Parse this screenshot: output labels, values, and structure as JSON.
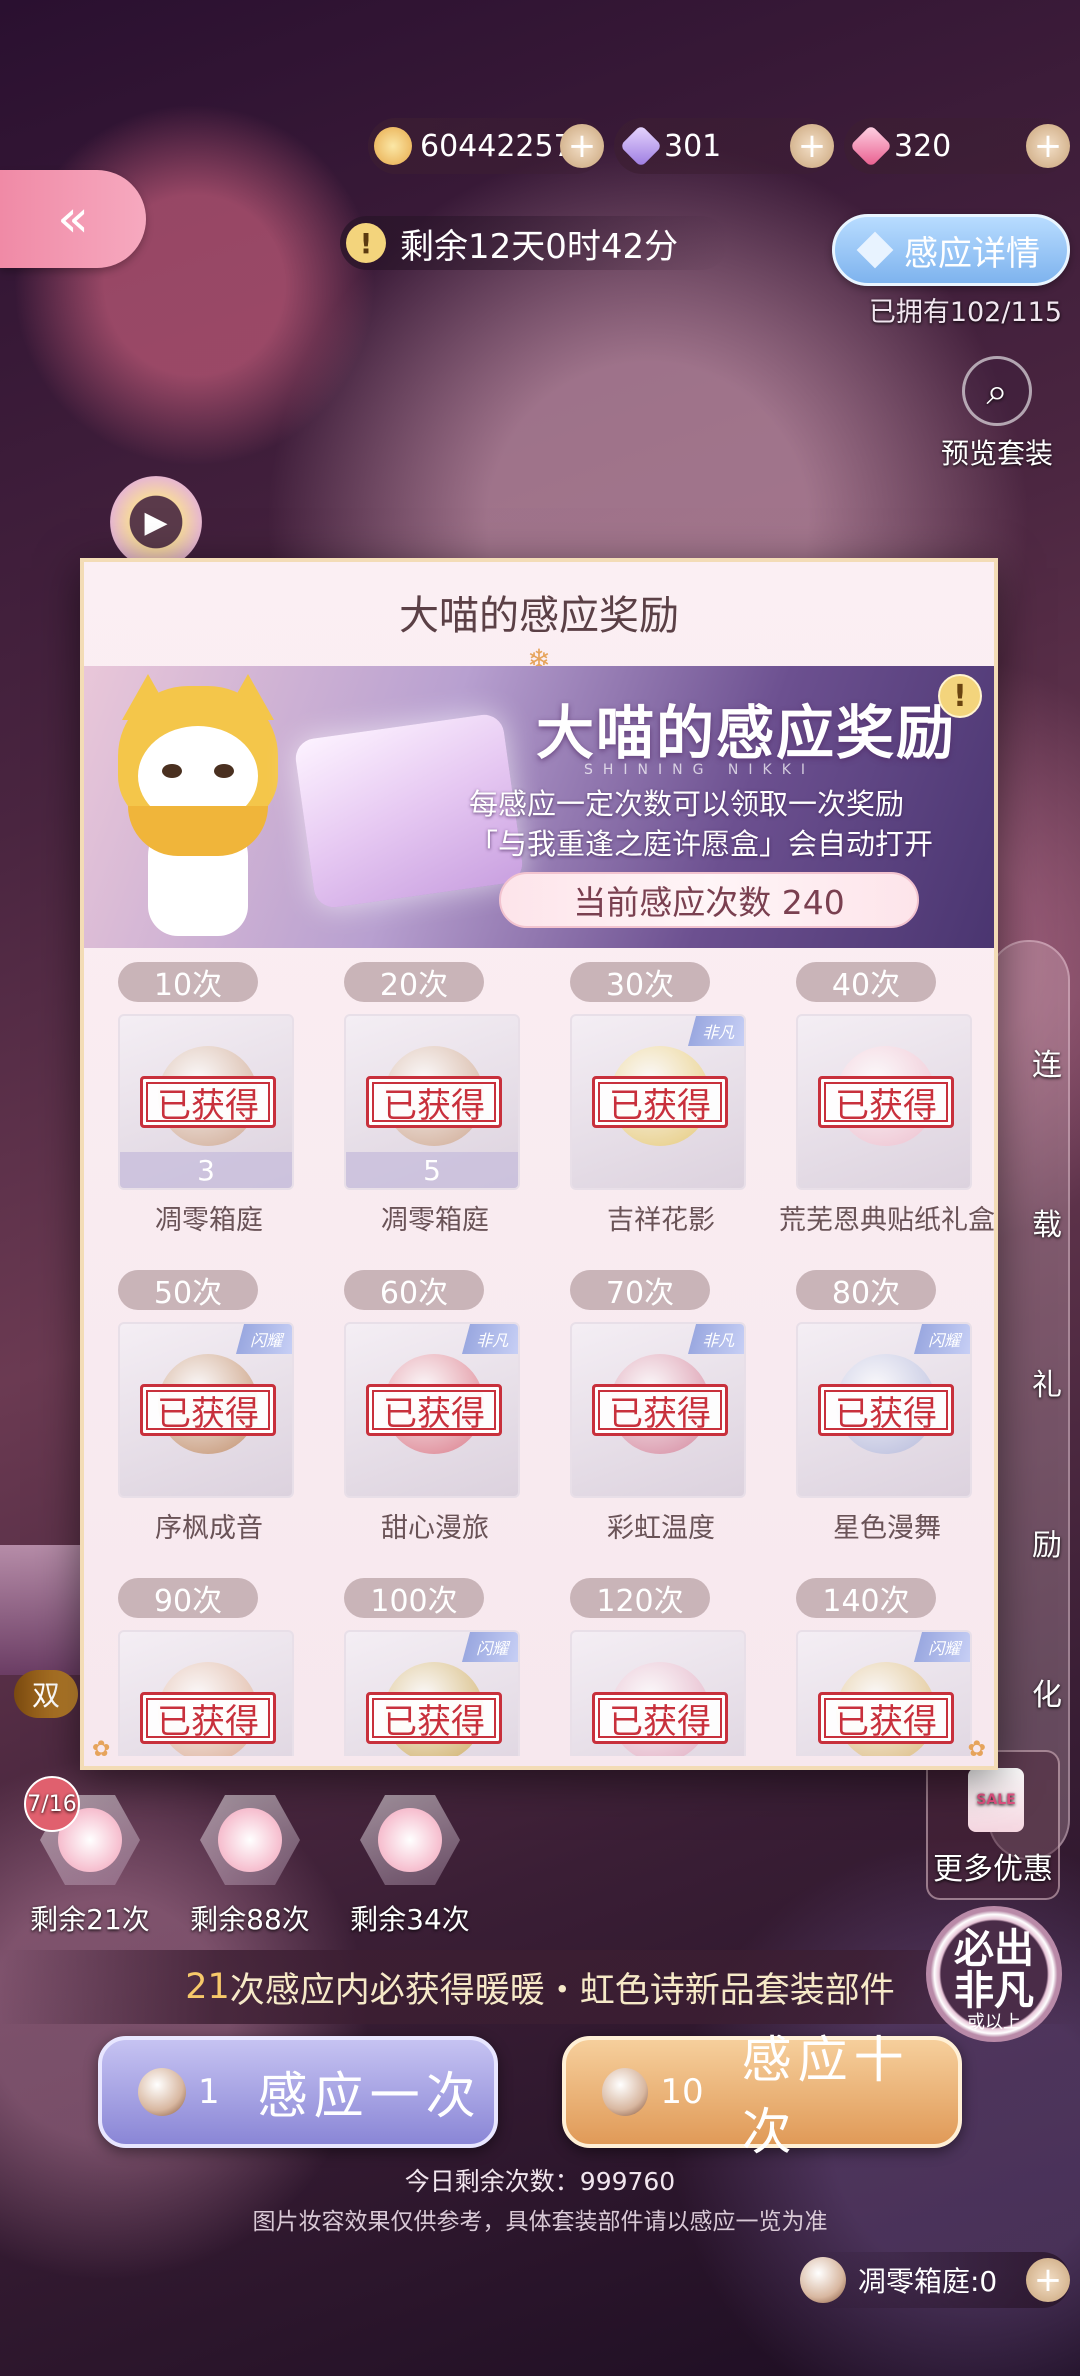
{
  "resources": {
    "gold": "60442257",
    "diamond": "301",
    "pink_diamond": "320",
    "plus": "+"
  },
  "back_label": "«",
  "timer": {
    "icon": "!",
    "text": "剩余12天0时42分"
  },
  "detail_button": "感应详情",
  "owned": "已拥有102/115",
  "preview": {
    "icon": "search-icon",
    "label": "预览套装"
  },
  "play_icon": "▶",
  "side_menu": [
    "连",
    "载",
    "礼",
    "励",
    "化"
  ],
  "more_deals": {
    "sale": "SALE",
    "label": "更多优惠"
  },
  "left_badge_label": "双",
  "modal": {
    "header": "大喵的感应奖励",
    "banner_title": "大喵的感应奖励",
    "banner_sub": "SHINING NIKKI",
    "desc_line1": "每感应一定次数可以领取一次奖励",
    "desc_line2": "「与我重逢之庭许愿盒」会自动打开",
    "count_label": "当前感应次数 240",
    "info": "!",
    "stamp": "已获得",
    "tiles": [
      {
        "threshold": "10次",
        "name": "凋零箱庭",
        "qty": "3",
        "tag": "",
        "art": "#c89a7a"
      },
      {
        "threshold": "20次",
        "name": "凋零箱庭",
        "qty": "5",
        "tag": "",
        "art": "#c89a7a"
      },
      {
        "threshold": "30次",
        "name": "吉祥花影",
        "qty": "",
        "tag": "非凡",
        "art": "#e6c45a"
      },
      {
        "threshold": "40次",
        "name": "荒芜恩典贴纸礼盒",
        "qty": "",
        "tag": "",
        "art": "#f0b8c8"
      },
      {
        "threshold": "50次",
        "name": "序枫成音",
        "qty": "",
        "tag": "闪耀",
        "art": "#b87a4a"
      },
      {
        "threshold": "60次",
        "name": "甜心漫旅",
        "qty": "",
        "tag": "非凡",
        "art": "#d86070"
      },
      {
        "threshold": "70次",
        "name": "彩虹温度",
        "qty": "",
        "tag": "非凡",
        "art": "#d0708a"
      },
      {
        "threshold": "80次",
        "name": "星色漫舞",
        "qty": "",
        "tag": "闪耀",
        "art": "#a8b0d8"
      },
      {
        "threshold": "90次",
        "name": "",
        "qty": "",
        "tag": "",
        "art": "#d8a080"
      },
      {
        "threshold": "100次",
        "name": "",
        "qty": "",
        "tag": "闪耀",
        "art": "#c8a040"
      },
      {
        "threshold": "120次",
        "name": "",
        "qty": "",
        "tag": "",
        "art": "#e0a0b8"
      },
      {
        "threshold": "140次",
        "name": "",
        "qty": "",
        "tag": "闪耀",
        "art": "#d8b060"
      }
    ]
  },
  "pity": [
    {
      "label": "剩余21次",
      "badge": "7/16"
    },
    {
      "label": "剩余88次",
      "badge": ""
    },
    {
      "label": "剩余34次",
      "badge": ""
    }
  ],
  "guarantee": {
    "count": "21",
    "text": "次感应内必获得暖暖・虹色诗新品套装部件"
  },
  "must_badge": {
    "line1": "必出",
    "line2": "非凡",
    "line3": "或以上"
  },
  "pull_one": {
    "cost": "1",
    "label": "感应一次"
  },
  "pull_ten": {
    "cost": "10",
    "label": "感应十次"
  },
  "remaining_today": "今日剩余次数：999760",
  "disclaimer": "图片妆容效果仅供参考，具体套装部件请以感应一览为准",
  "withered_box": {
    "label": "凋零箱庭:0",
    "plus": "+"
  }
}
